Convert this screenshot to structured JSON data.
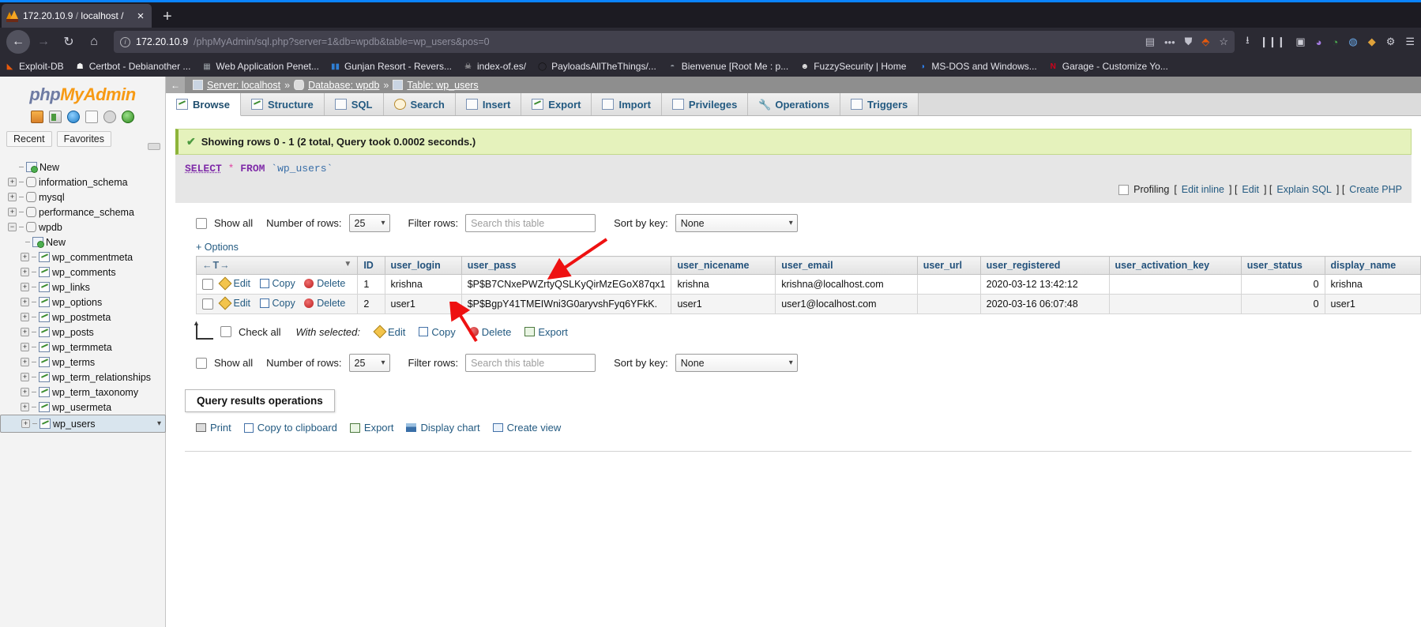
{
  "browser": {
    "tab": {
      "title_host": "172.20.10.9",
      "title_sep": " / ",
      "title_rest": "localhost / ",
      "favicon": "phpmyadmin-icon",
      "close": "×"
    },
    "newtab_label": "+",
    "nav": {
      "back": "←",
      "forward": "→",
      "reload": "↻",
      "home": "⌂"
    },
    "url": {
      "host": "172.20.10.9",
      "path": "/phpMyAdmin/sql.php?server=1&db=wpdb&table=wp_users&pos=0",
      "info_icon": "info-icon",
      "reader_icon": "reader-view-icon",
      "more_icon": "page-actions-icon",
      "shield_icon": "tracking-protection-icon",
      "star_icon": "bookmark-star-icon",
      "pocket_icon": "pocket-icon"
    },
    "toolbar_right": [
      "download-icon",
      "library-icon",
      "screenshot-icon",
      "account-icon",
      "sync-icon",
      "globe-icon",
      "extension-icon",
      "settings-icon",
      "menu-icon"
    ],
    "bookmarks": [
      {
        "label": "Exploit-DB",
        "icon": "flame-icon",
        "color": "#e8590c"
      },
      {
        "label": "Certbot - Debianother ...",
        "icon": "ghost-icon",
        "color": "#f2f2f2"
      },
      {
        "label": "Web Application Penet...",
        "icon": "page-icon",
        "color": "#9aa0a6"
      },
      {
        "label": "Gunjan Resort - Revers...",
        "icon": "bars-icon",
        "color": "#2f7fd4"
      },
      {
        "label": "index-of.es/",
        "icon": "skull-icon",
        "color": "#d9d9d9"
      },
      {
        "label": "PayloadsAllTheThings/...",
        "icon": "circle-icon",
        "color": "#1a1a1a"
      },
      {
        "label": "Bienvenue [Root Me : p...",
        "icon": "shield-icon",
        "color": "#8a8f98"
      },
      {
        "label": "FuzzySecurity | Home",
        "icon": "alien-icon",
        "color": "#e6e6e6"
      },
      {
        "label": "MS-DOS and Windows...",
        "icon": "droplet-icon",
        "color": "#2f80ed"
      },
      {
        "label": "Garage - Customize Yo...",
        "icon": "n-letter-icon",
        "color": "#d0021b"
      }
    ]
  },
  "sidebar": {
    "logo": {
      "part1": "php",
      "part2": "MyAdmin"
    },
    "icons": [
      "home-icon",
      "exit-icon",
      "help-icon",
      "docs-icon",
      "settings-gear-icon",
      "reload-icon"
    ],
    "tabs": [
      {
        "label": "Recent"
      },
      {
        "label": "Favorites"
      }
    ],
    "tree": [
      {
        "label": "New",
        "level": 0,
        "toggle": "",
        "icon": "new-database-icon"
      },
      {
        "label": "information_schema",
        "level": 0,
        "toggle": "+",
        "icon": "database-icon"
      },
      {
        "label": "mysql",
        "level": 0,
        "toggle": "+",
        "icon": "database-icon"
      },
      {
        "label": "performance_schema",
        "level": 0,
        "toggle": "+",
        "icon": "database-icon"
      },
      {
        "label": "wpdb",
        "level": 0,
        "toggle": "−",
        "icon": "database-icon"
      },
      {
        "label": "New",
        "level": 1,
        "toggle": "",
        "icon": "new-table-icon"
      },
      {
        "label": "wp_commentmeta",
        "level": 1,
        "toggle": "+",
        "icon": "table-icon"
      },
      {
        "label": "wp_comments",
        "level": 1,
        "toggle": "+",
        "icon": "table-icon"
      },
      {
        "label": "wp_links",
        "level": 1,
        "toggle": "+",
        "icon": "table-icon"
      },
      {
        "label": "wp_options",
        "level": 1,
        "toggle": "+",
        "icon": "table-icon"
      },
      {
        "label": "wp_postmeta",
        "level": 1,
        "toggle": "+",
        "icon": "table-icon"
      },
      {
        "label": "wp_posts",
        "level": 1,
        "toggle": "+",
        "icon": "table-icon"
      },
      {
        "label": "wp_termmeta",
        "level": 1,
        "toggle": "+",
        "icon": "table-icon"
      },
      {
        "label": "wp_terms",
        "level": 1,
        "toggle": "+",
        "icon": "table-icon"
      },
      {
        "label": "wp_term_relationships",
        "level": 1,
        "toggle": "+",
        "icon": "table-icon"
      },
      {
        "label": "wp_term_taxonomy",
        "level": 1,
        "toggle": "+",
        "icon": "table-icon"
      },
      {
        "label": "wp_usermeta",
        "level": 1,
        "toggle": "+",
        "icon": "table-icon"
      },
      {
        "label": "wp_users",
        "level": 1,
        "toggle": "+",
        "icon": "table-icon",
        "selected": true
      }
    ]
  },
  "main": {
    "breadcrumb": {
      "server_label": "Server: localhost",
      "database_label": "Database: wpdb",
      "table_label": "Table: wp_users",
      "separator": "»",
      "back": "←"
    },
    "tabs": [
      {
        "label": "Browse",
        "icon": "browse-icon",
        "active": true
      },
      {
        "label": "Structure",
        "icon": "structure-icon",
        "active": false
      },
      {
        "label": "SQL",
        "icon": "sql-icon",
        "active": false
      },
      {
        "label": "Search",
        "icon": "search-icon",
        "active": false
      },
      {
        "label": "Insert",
        "icon": "insert-icon",
        "active": false
      },
      {
        "label": "Export",
        "icon": "export-icon",
        "active": false
      },
      {
        "label": "Import",
        "icon": "import-icon",
        "active": false
      },
      {
        "label": "Privileges",
        "icon": "privileges-icon",
        "active": false
      },
      {
        "label": "Operations",
        "icon": "operations-wrench-icon",
        "active": false
      },
      {
        "label": "Triggers",
        "icon": "triggers-icon",
        "active": false
      }
    ],
    "result_message": "Showing rows 0 - 1 (2 total, Query took 0.0002 seconds.)",
    "sql": {
      "keyword1": "SELECT",
      "star": "*",
      "keyword2": "FROM",
      "table": "`wp_users`"
    },
    "profiling": {
      "label": "Profiling",
      "bracket_open": "[",
      "edit_inline": "Edit inline",
      "bracket_mid1": "] [",
      "edit": "Edit",
      "bracket_mid2": "] [",
      "explain_sql": "Explain SQL",
      "bracket_mid3": "] [",
      "create_php": "Create PHP"
    },
    "controls_top": {
      "show_all": "Show all",
      "number_of_rows_label": "Number of rows:",
      "number_of_rows_value": "25",
      "filter_rows_label": "Filter rows:",
      "filter_placeholder": "Search this table",
      "sort_by_key_label": "Sort by key:",
      "sort_by_key_value": "None"
    },
    "options_link": "+ Options",
    "table": {
      "nav_header": "←T→",
      "columns": [
        "ID",
        "user_login",
        "user_pass",
        "user_nicename",
        "user_email",
        "user_url",
        "user_registered",
        "user_activation_key",
        "user_status",
        "display_name"
      ],
      "row_actions": {
        "edit": "Edit",
        "copy": "Copy",
        "delete": "Delete"
      },
      "rows": [
        {
          "ID": "1",
          "user_login": "krishna",
          "user_pass": "$P$B7CNxePWZrtyQSLKyQirMzEGoX87qx1",
          "user_nicename": "krishna",
          "user_email": "krishna@localhost.com",
          "user_url": "",
          "user_registered": "2020-03-12 13:42:12",
          "user_activation_key": "",
          "user_status": "0",
          "display_name": "krishna"
        },
        {
          "ID": "2",
          "user_login": "user1",
          "user_pass": "$P$BgpY41TMEIWni3G0aryvshFyq6YFkK.",
          "user_nicename": "user1",
          "user_email": "user1@localhost.com",
          "user_url": "",
          "user_registered": "2020-03-16 06:07:48",
          "user_activation_key": "",
          "user_status": "0",
          "display_name": "user1"
        }
      ]
    },
    "with_selected": {
      "check_all": "Check all",
      "label": "With selected:",
      "edit": "Edit",
      "copy": "Copy",
      "delete": "Delete",
      "export": "Export"
    },
    "controls_bottom": {
      "show_all": "Show all",
      "number_of_rows_label": "Number of rows:",
      "number_of_rows_value": "25",
      "filter_rows_label": "Filter rows:",
      "filter_placeholder": "Search this table",
      "sort_by_key_label": "Sort by key:",
      "sort_by_key_value": "None"
    },
    "query_results_operations": {
      "title": "Query results operations",
      "links": [
        {
          "label": "Print",
          "icon": "printer-icon"
        },
        {
          "label": "Copy to clipboard",
          "icon": "clipboard-icon"
        },
        {
          "label": "Export",
          "icon": "export-icon"
        },
        {
          "label": "Display chart",
          "icon": "chart-icon"
        },
        {
          "label": "Create view",
          "icon": "view-icon"
        }
      ]
    }
  },
  "annotations": {
    "arrow_color": "#ee1111",
    "arrow1": "points-to-user_pass-header",
    "arrow2": "points-to-user_pass-row2"
  }
}
